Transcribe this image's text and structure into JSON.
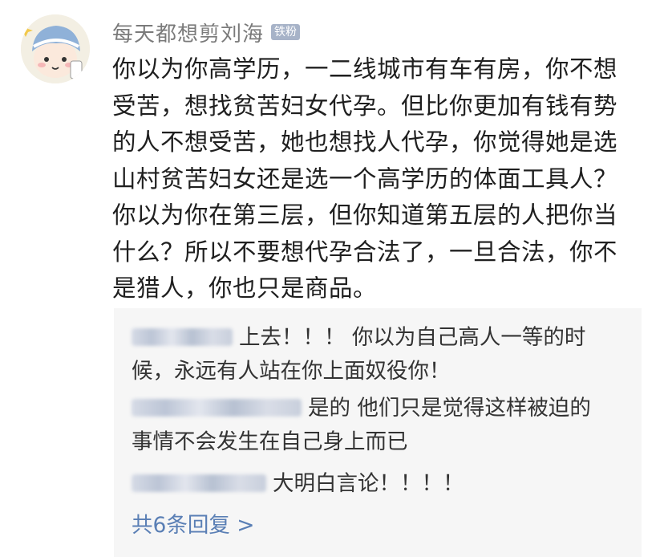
{
  "comment": {
    "username": "每天都想剪刘海",
    "badge": "铁粉",
    "text": "你以为你高学历，一二线城市有车有房，你不想\n受苦，想找贫苦妇女代孕。但比你更加有钱有势\n的人不想受苦，她也想找人代孕，你觉得她是选\n山村贫苦妇女还是选一个高学历的体面工具人？\n你以为你在第三层，但你知道第五层的人把你当\n什么？所以不要想代孕合法了，一旦合法，你不\n是猎人，你也只是商品。"
  },
  "replies": [
    {
      "text": "上去！！！ 你以为自己高人一等的时\n候，永远有人站在你上面奴役你！"
    },
    {
      "text": "是的 他们只是觉得这样被迫的\n事情不会发生在自己身上而已"
    },
    {
      "text": "大明白言论！！！！"
    }
  ],
  "more_replies": "共6条回复 >",
  "colors": {
    "username": "#7a7a7a",
    "badge_bg": "#a7b3c8",
    "reply_bg": "#f6f6f6",
    "link": "#5a7fb5"
  }
}
